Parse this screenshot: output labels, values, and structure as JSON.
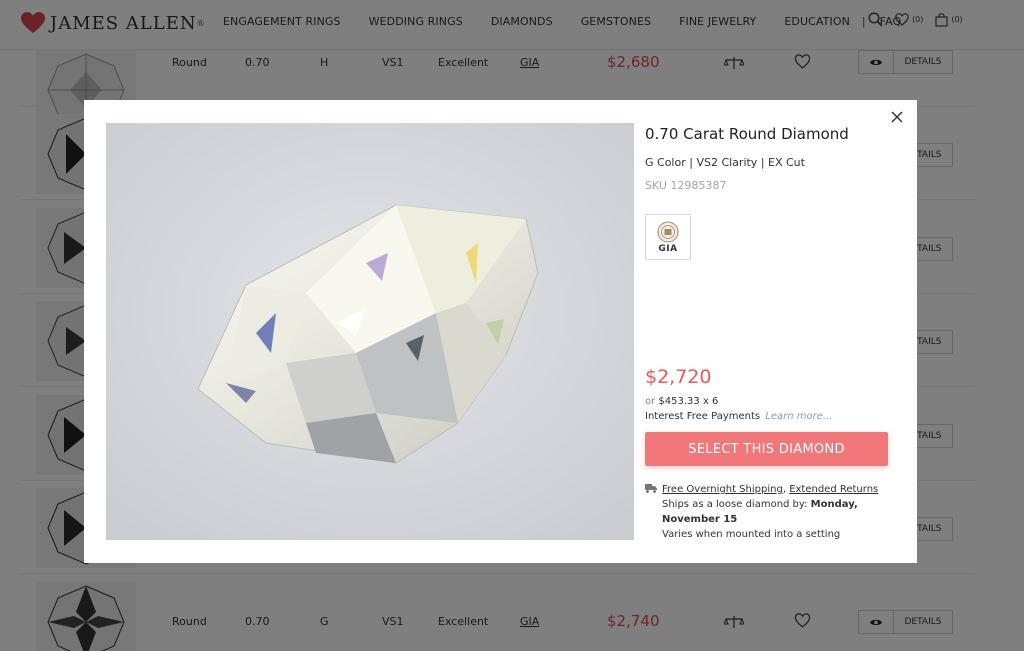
{
  "brand": {
    "name": "JAMES ALLEN",
    "reg": "®",
    "heart_color": "#d9474b"
  },
  "nav": {
    "items": [
      "ENGAGEMENT RINGS",
      "WEDDING RINGS",
      "DIAMONDS",
      "GEMSTONES",
      "FINE JEWELRY",
      "EDUCATION"
    ],
    "separator": "|",
    "faq": "FAQ"
  },
  "header_icons": {
    "search": "search-icon",
    "wishlist": "heart-icon",
    "wishlist_count": "(0)",
    "cart": "bag-icon",
    "cart_count": "(0)"
  },
  "rows": [
    {
      "shape": "Round",
      "carat": "0.70",
      "color": "H",
      "clarity": "VS1",
      "cut": "Excellent",
      "lab": "GIA",
      "price": "$2,680",
      "details": "DETAILS"
    },
    {
      "details": "DETAILS"
    },
    {
      "details": "DETAILS"
    },
    {
      "details": "DETAILS"
    },
    {
      "details": "DETAILS"
    },
    {
      "details": "DETAILS"
    },
    {
      "shape": "Round",
      "carat": "0.70",
      "color": "G",
      "clarity": "VS1",
      "cut": "Excellent",
      "lab": "GIA",
      "price": "$2,740",
      "details": "DETAILS"
    }
  ],
  "modal": {
    "title": "0.70 Carat Round Diamond",
    "specs": "G Color  |  VS2 Clarity  |  EX Cut",
    "sku": "SKU 12985387",
    "cert_label": "GIA",
    "price": "$2,720",
    "installment_or": "or",
    "installment_value": "$453.33 x 6",
    "interest_free": "Interest Free Payments",
    "learn_more": "Learn more...",
    "select_button": "SELECT THIS DIAMOND",
    "free_shipping": "Free Overnight Shipping",
    "comma": ",",
    "extended_returns": "Extended Returns",
    "ships_as": "Ships as a loose diamond by:",
    "ship_date": "Monday, November 15",
    "varies": "Varies when mounted into a setting",
    "accent_color": "#f2777a",
    "price_color": "#e8595b"
  }
}
